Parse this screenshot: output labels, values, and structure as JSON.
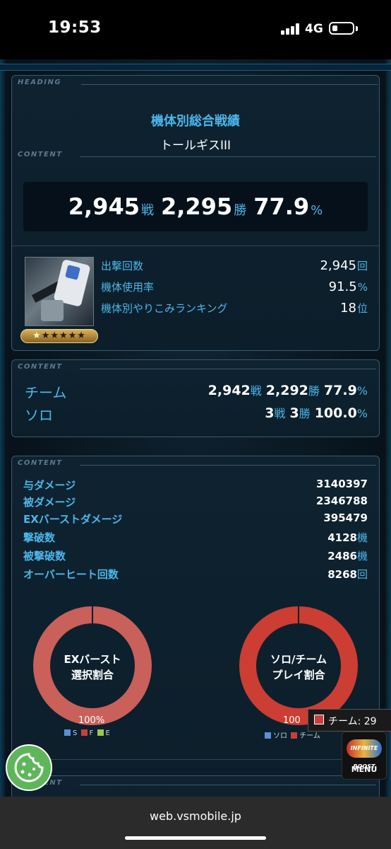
{
  "status_bar": {
    "time": "19:53",
    "network": "4G"
  },
  "heading": {
    "tag": "HEADING",
    "title": "機体別総合戦績",
    "unit_name": "トールギスIII"
  },
  "overview": {
    "tag": "CONTENT",
    "battles": "2,945",
    "battles_unit": "戦",
    "wins": "2,295",
    "wins_unit": "勝",
    "win_rate": "77.9",
    "percent_unit": "%",
    "rarity_stars": 5,
    "star_glyphs": "★★★★★",
    "stats": [
      {
        "label": "出撃回数",
        "value": "2,945",
        "unit": "回"
      },
      {
        "label": "機体使用率",
        "value": "91.5",
        "unit": "%"
      },
      {
        "label": "機体別やりこみランキング",
        "value": "18",
        "unit": "位"
      }
    ]
  },
  "modes": {
    "tag": "CONTENT",
    "team": {
      "label": "チーム",
      "battles": "2,942",
      "battles_unit": "戦",
      "wins": "2,292",
      "wins_unit": "勝",
      "rate": "77.9",
      "rate_unit": "%"
    },
    "solo": {
      "label": "ソロ",
      "battles": "3",
      "battles_unit": "戦",
      "wins": "3",
      "wins_unit": "勝",
      "rate": "100.0",
      "rate_unit": "%"
    }
  },
  "details": {
    "tag": "CONTENT",
    "rows": [
      {
        "label": "与ダメージ",
        "value": "3140397",
        "unit": ""
      },
      {
        "label": "被ダメージ",
        "value": "2346788",
        "unit": ""
      },
      {
        "label": "EXバーストダメージ",
        "value": "395479",
        "unit": ""
      },
      {
        "label": "撃破数",
        "value": "4128",
        "unit": "機"
      },
      {
        "label": "被撃破数",
        "value": "2486",
        "unit": "機"
      },
      {
        "label": "オーバーヒート回数",
        "value": "8268",
        "unit": "回"
      }
    ]
  },
  "burst_chart": {
    "label_line1": "EXバースト",
    "label_line2": "選択割合",
    "percent_label": "100%",
    "legend": [
      {
        "key": "S",
        "color": "#5b8fd6"
      },
      {
        "key": "F",
        "color": "#c9403a"
      },
      {
        "key": "E",
        "color": "#9bc74f"
      }
    ],
    "ring_color": "#c9605a"
  },
  "play_chart": {
    "label_line1": "ソロ/チーム",
    "label_line2": "プレイ割合",
    "percent_label": "100",
    "legend": [
      {
        "key": "ソロ",
        "color": "#5b8fd6"
      },
      {
        "key": "チーム",
        "color": "#c9403a"
      }
    ],
    "ring_color": "#cc3d33",
    "tooltip": "チーム: 29"
  },
  "footer_tag": "CONTENT",
  "menu": {
    "logo_text": "INFINITE BOOST",
    "label": "MENU"
  },
  "cookie_icon": "cookie-icon",
  "browser": {
    "url": "web.vsmobile.jp"
  }
}
